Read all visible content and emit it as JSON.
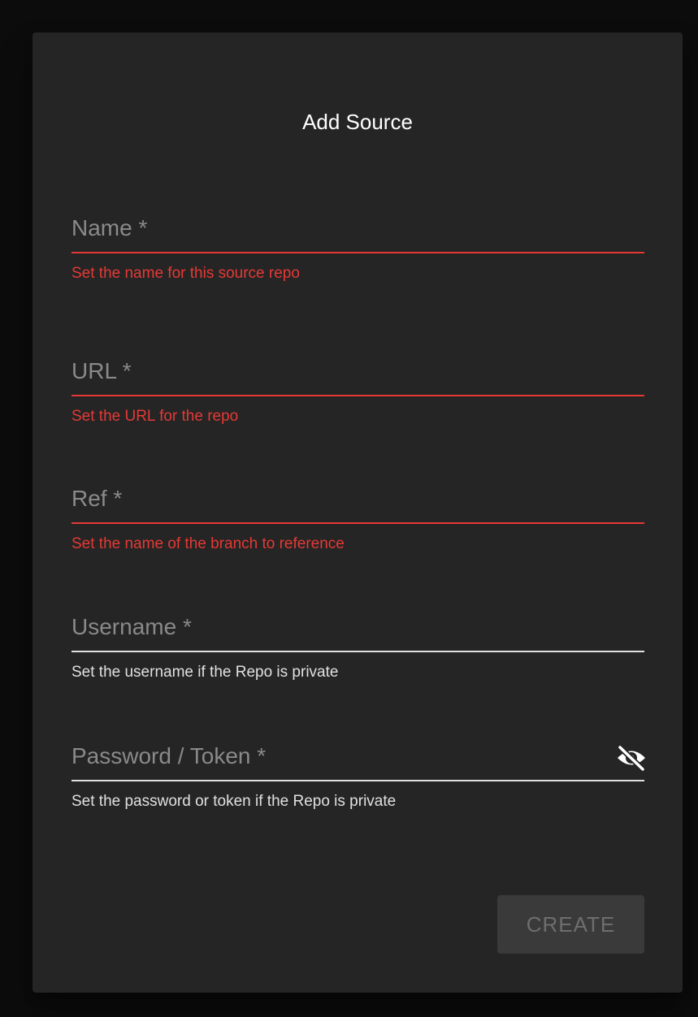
{
  "dialog": {
    "title": "Add Source"
  },
  "fields": {
    "name": {
      "placeholder": "Name *",
      "helper": "Set the name for this source repo",
      "state": "error"
    },
    "url": {
      "placeholder": "URL *",
      "helper": "Set the URL for the repo",
      "state": "error"
    },
    "ref": {
      "placeholder": "Ref *",
      "helper": "Set the name of the branch to reference",
      "state": "error"
    },
    "username": {
      "placeholder": "Username *",
      "helper": "Set the username if the Repo is private",
      "state": "normal"
    },
    "password": {
      "placeholder": "Password / Token *",
      "helper": "Set the password or token if the Repo is private",
      "state": "normal",
      "toggle_icon": "eye-off-icon"
    }
  },
  "actions": {
    "create_label": "CREATE",
    "create_disabled": true
  },
  "colors": {
    "background": "#0c0c0c",
    "dialog": "#252525",
    "error": "#e53935",
    "text_primary": "#ffffff",
    "text_secondary": "#e0e0e0",
    "placeholder": "#8a8a8a",
    "button_disabled_bg": "#3a3a3a",
    "button_disabled_text": "#6e6e6e"
  }
}
